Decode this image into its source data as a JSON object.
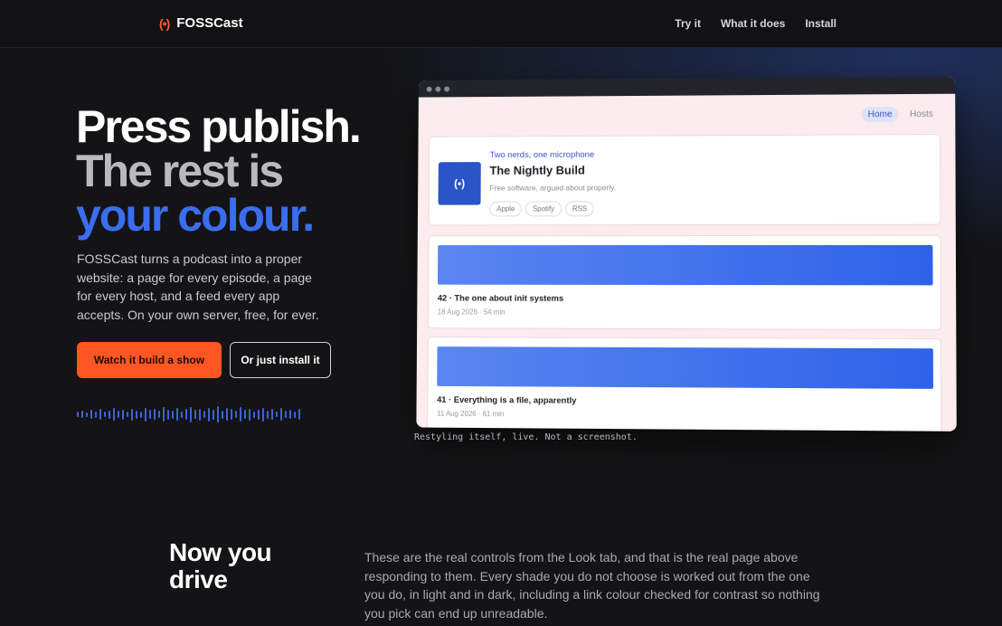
{
  "brand": {
    "mark": "(•)",
    "name": "FOSSCast"
  },
  "nav": [
    {
      "label": "Try it"
    },
    {
      "label": "What it does"
    },
    {
      "label": "Install"
    }
  ],
  "hero": {
    "line1": "Press publish.",
    "line2": "The rest is",
    "line3": "your colour.",
    "lead": "FOSSCast turns a podcast into a proper website: a page for every episode, a page for every host, and a feed every app accepts. On your own server, free, for ever.",
    "primary_button": "Watch it build a show",
    "secondary_button": "Or just install it"
  },
  "preview": {
    "nav_active": "Home",
    "nav_other": "Hosts",
    "show": {
      "art_glyph": "(•)",
      "kicker": "Two nerds, one microphone",
      "title": "The Nightly Build",
      "description": "Free software, argued about properly.",
      "chips": [
        "Apple",
        "Spotify",
        "RSS"
      ]
    },
    "episodes": [
      {
        "title": "42 · The one about init systems",
        "meta": "18 Aug 2026 · 54 min"
      },
      {
        "title": "41 · Everything is a file, apparently",
        "meta": "11 Aug 2026 · 61 min"
      }
    ],
    "caption": "Restyling itself, live. Not a screenshot."
  },
  "section": {
    "title": "Now you drive",
    "text": "These are the real controls from the Look tab, and that is the real page above responding to them. Every shade you do not choose is worked out from the one you do, in light and in dark, including a link colour checked for contrast so nothing you pick can end up unreadable."
  },
  "colors": {
    "accent": "#ff5624",
    "blue": "#3a6df0",
    "background": "#141416"
  }
}
